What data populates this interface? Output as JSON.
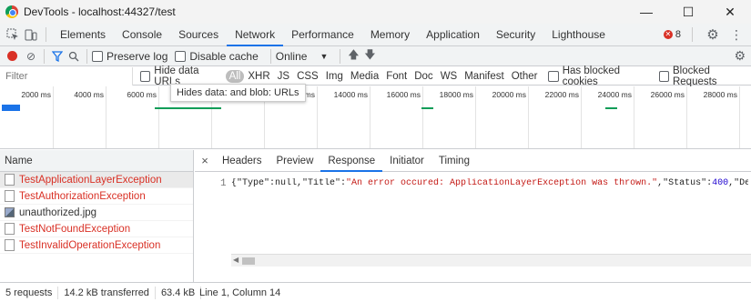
{
  "window": {
    "title": "DevTools - localhost:44327/test",
    "minimize_glyph": "—",
    "maximize_glyph": "☐",
    "close_glyph": "✕"
  },
  "tabs": [
    "Elements",
    "Console",
    "Sources",
    "Network",
    "Performance",
    "Memory",
    "Application",
    "Security",
    "Lighthouse"
  ],
  "active_tab": "Network",
  "error_count": "8",
  "toolbar": {
    "preserve_log": "Preserve log",
    "disable_cache": "Disable cache",
    "throttle": "Online"
  },
  "filter": {
    "placeholder": "Filter",
    "hide_data_urls": "Hide data URLs",
    "types": [
      "All",
      "XHR",
      "JS",
      "CSS",
      "Img",
      "Media",
      "Font",
      "Doc",
      "WS",
      "Manifest",
      "Other"
    ],
    "has_blocked_cookies": "Has blocked cookies",
    "blocked_requests": "Blocked Requests"
  },
  "tooltip": "Hides data: and blob: URLs",
  "timeline_ticks": [
    "2000 ms",
    "4000 ms",
    "6000 ms",
    "",
    "",
    "0 ms",
    "14000 ms",
    "16000 ms",
    "18000 ms",
    "20000 ms",
    "22000 ms",
    "24000 ms",
    "26000 ms",
    "28000 ms"
  ],
  "requests_header": "Name",
  "requests": [
    {
      "name": "TestApplicationLayerException",
      "status": "error",
      "icon": "file-icon"
    },
    {
      "name": "TestAuthorizationException",
      "status": "error",
      "icon": "file-icon"
    },
    {
      "name": "unauthorized.jpg",
      "status": "ok",
      "icon": "image-icon"
    },
    {
      "name": "TestNotFoundException",
      "status": "error",
      "icon": "file-icon"
    },
    {
      "name": "TestInvalidOperationException",
      "status": "error",
      "icon": "file-icon"
    }
  ],
  "detail_tabs": [
    "Headers",
    "Preview",
    "Response",
    "Initiator",
    "Timing"
  ],
  "active_detail_tab": "Response",
  "response": {
    "line_number": "1",
    "p1": "{\"Type\":null,\"Title\":",
    "p2": "\"An error occured: ApplicationLayerException was thrown.\"",
    "p3": ",\"Status\":",
    "p4": "400",
    "p5": ",\"Detail\""
  },
  "status": {
    "requests": "5 requests",
    "transferred": "14.2 kB transferred",
    "resources": "63.4 kB",
    "cursor": "Line 1, Column 14"
  },
  "colors": {
    "accent": "#1a73e8",
    "error": "#d93025",
    "record": "#d93025"
  }
}
